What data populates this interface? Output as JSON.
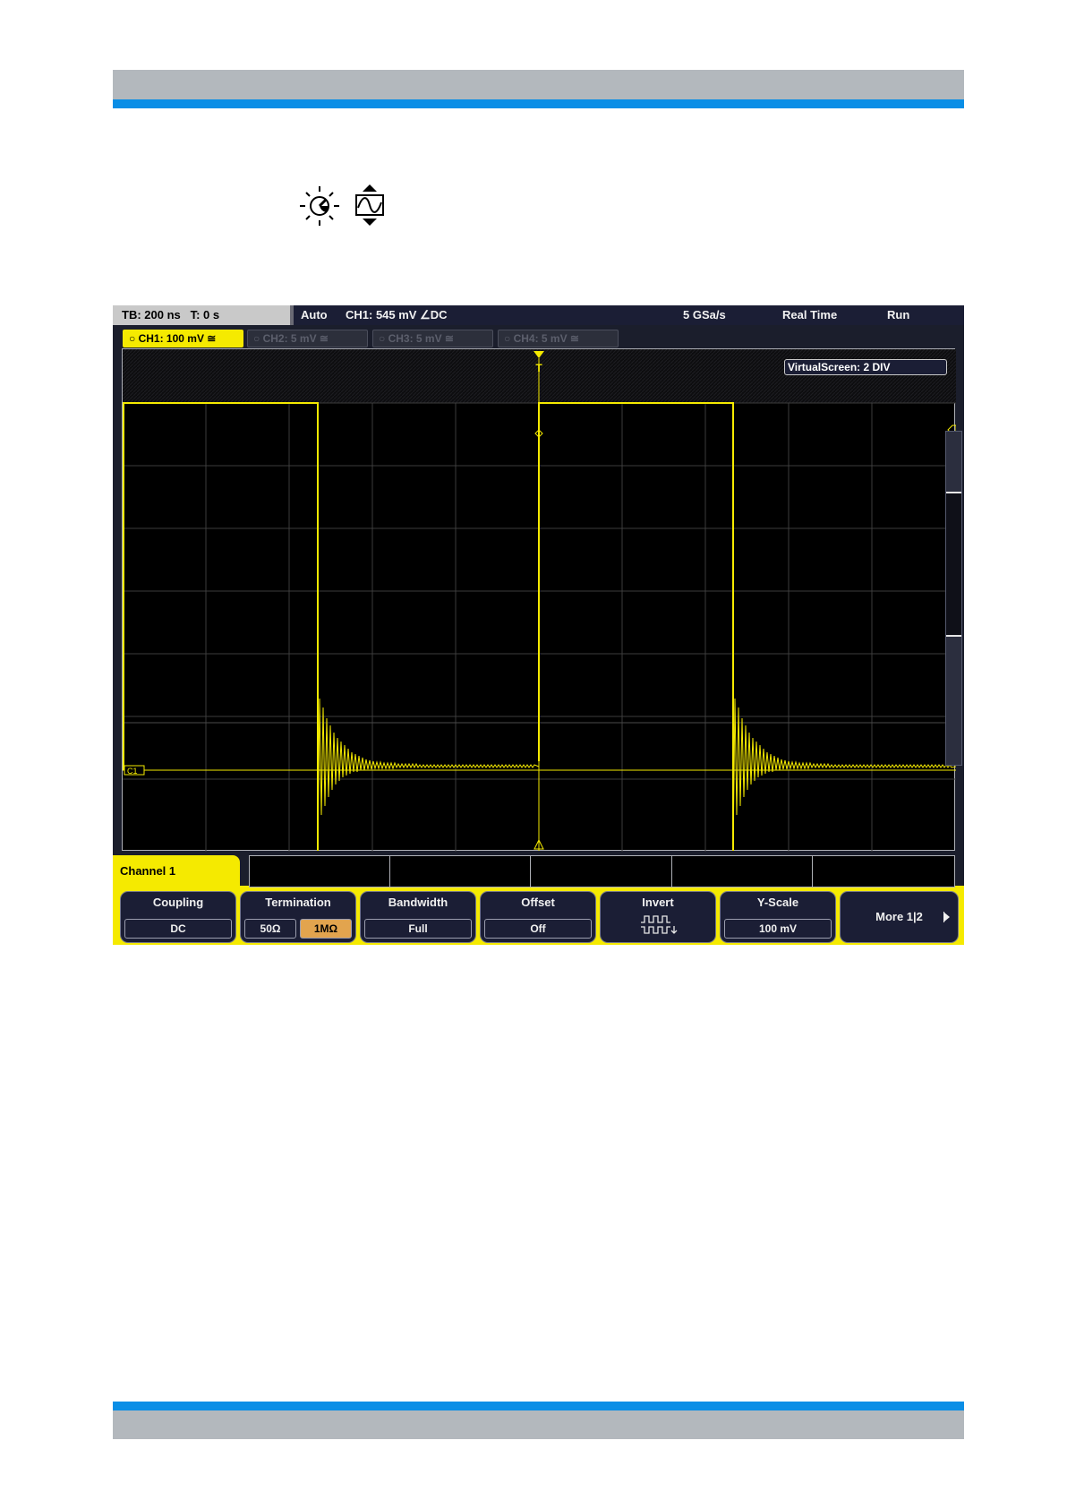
{
  "status_bar": {
    "timebase": "TB: 200 ns",
    "trigger_time": "T: 0 s",
    "acq_mode": "Auto",
    "trigger_info": "CH1: 545 mV ∠DC",
    "sample_rate": "5 GSa/s",
    "realtime": "Real Time",
    "run_state": "Run"
  },
  "channel_tabs": [
    {
      "label": "○ CH1: 100 mV ≅",
      "active": true
    },
    {
      "label": "○ CH2: 5 mV ≅",
      "active": false
    },
    {
      "label": "○ CH3: 5 mV ≅",
      "active": false
    },
    {
      "label": "○ CH4: 5 mV ≅",
      "active": false
    }
  ],
  "virtual_screen": "VirtualScreen: 2 DIV",
  "markers": {
    "trigger": "T",
    "channel": "C1"
  },
  "menu_title": "Channel 1",
  "softkeys": {
    "coupling": {
      "label": "Coupling",
      "value": "DC"
    },
    "termination": {
      "label": "Termination",
      "options": [
        "50Ω",
        "1MΩ"
      ],
      "selected": "1MΩ"
    },
    "bandwidth": {
      "label": "Bandwidth",
      "value": "Full"
    },
    "offset": {
      "label": "Offset",
      "value": "Off"
    },
    "invert": {
      "label": "Invert"
    },
    "yscale": {
      "label": "Y-Scale",
      "value": "100 mV"
    },
    "more": {
      "label": "More 1|2"
    }
  },
  "colors": {
    "trace": "#f5ea00",
    "accent": "#0a8ee6",
    "band": "#b3b8bd"
  }
}
